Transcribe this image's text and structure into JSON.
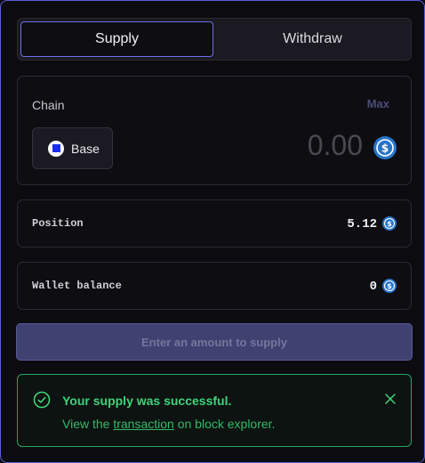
{
  "tabs": [
    {
      "label": "Supply",
      "active": true
    },
    {
      "label": "Withdraw",
      "active": false
    }
  ],
  "amount_card": {
    "chain_label": "Chain",
    "max_label": "Max",
    "chain": {
      "name": "Base",
      "icon": "base-chain-icon"
    },
    "amount_value": "",
    "amount_placeholder": "0.00",
    "token_icon": "usdc-icon"
  },
  "position": {
    "label": "Position",
    "value": "5.12",
    "token_icon": "usdc-icon"
  },
  "wallet_balance": {
    "label": "Wallet balance",
    "value": "0",
    "token_icon": "usdc-icon"
  },
  "submit": {
    "label": "Enter an amount to supply",
    "disabled": true
  },
  "toast": {
    "title": "Your supply was successful.",
    "body_prefix": "View the ",
    "link_text": "transaction",
    "body_suffix": " on block explorer.",
    "status": "success",
    "icons": [
      "check-circle-icon",
      "close-icon"
    ]
  },
  "colors": {
    "background": "#0c0b10",
    "accent": "#5a5fd6",
    "usdc": "#2775ca",
    "success": "#3fd37a",
    "button_disabled": "#3f4270"
  }
}
